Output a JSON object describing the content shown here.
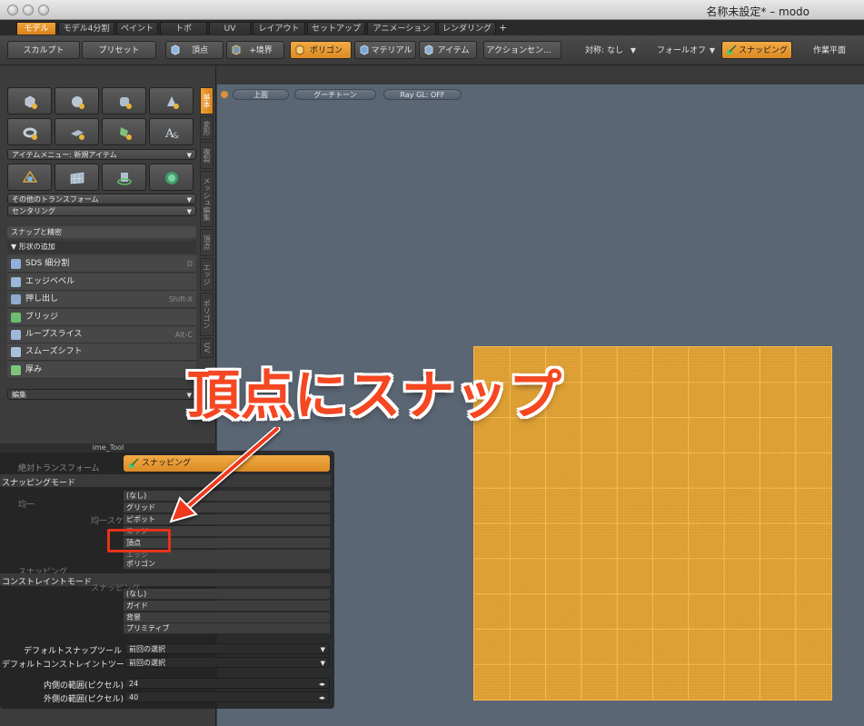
{
  "window": {
    "title": "名称未設定* – modo"
  },
  "tabs": [
    "モデル",
    "モデル4分割",
    "ペイント",
    "トポ",
    "UV",
    "レイアウト",
    "セットアップ",
    "アニメーション",
    "レンダリング"
  ],
  "tab_add": "+",
  "toolbar": {
    "sculpt": "スカルプト",
    "preset": "プリセット",
    "vertex": "頂点",
    "edge": "+境界",
    "polygon": "ポリゴン",
    "material": "マテリアル",
    "item": "アイテム",
    "action_center": "アクションセン...",
    "symmetry": "対称: なし",
    "falloff": "フォールオフ",
    "snapping": "スナッピング",
    "workplane": "作業平面"
  },
  "left_panel": {
    "item_menu": "アイテムメニュー: 新規アイテム",
    "other_transform": "その他のトランスフォーム",
    "centering": "センタリング",
    "snap_header": "スナップと精密",
    "add_shape_header": "形状の追加",
    "tools": [
      {
        "label": "SDS 細分割",
        "key": "D"
      },
      {
        "label": "エッジベベル",
        "key": ""
      },
      {
        "label": "押し出し",
        "key": "Shift-X"
      },
      {
        "label": "ブリッジ",
        "key": ""
      },
      {
        "label": "ループスライス",
        "key": "Alt-C"
      },
      {
        "label": "スムーズシフト",
        "key": ""
      },
      {
        "label": "厚み",
        "key": ""
      }
    ],
    "edit_header": "編集"
  },
  "vertical_tabs": [
    "基本",
    "変形",
    "複製",
    "メッシュ編集",
    "頂点",
    "エッジ",
    "ポリゴン",
    "UV"
  ],
  "viewport": {
    "view_label": "上面",
    "shading_label": "グーチトーン",
    "raygl_label": "Ray GL: OFF"
  },
  "popup": {
    "tool_header": "ime_Tool",
    "absolute_transform": "絶対トランスフォーム",
    "snapping_button": "スナッピング",
    "snapping_mode_label": "スナッピングモード",
    "uniform_label": "均一",
    "uniform_scale_label": "均一スケール",
    "snapping_section": "スナッピング",
    "constraint_mode_label": "コンストレイントモード",
    "snapping_ghost": "スナッピング",
    "snap_modes": [
      "(なし)",
      "グリッド",
      "ピボット",
      "エッジ",
      "頂点",
      "エッジ",
      "ポリゴン"
    ],
    "constraint_modes": [
      "(なし)",
      "ガイド",
      "背景",
      "プリミティブ"
    ],
    "default_snap_tool_label": "デフォルトスナップツール",
    "default_snap_tool_value": "前回の選択",
    "default_constraint_tool_label": "デフォルトコンストレイントツール",
    "default_constraint_tool_value": "前回の選択",
    "inner_range_label": "内側の範囲(ピクセル)",
    "inner_range_value": "24",
    "outer_range_label": "外側の範囲(ピクセル)",
    "outer_range_value": "40"
  },
  "annotation": {
    "callout": "頂点にスナップ"
  },
  "colors": {
    "accent_orange": "#e39a2e",
    "annotation_red": "#f44722",
    "viewport_bg": "#5a6673",
    "mesh_fill": "#e3a538"
  }
}
